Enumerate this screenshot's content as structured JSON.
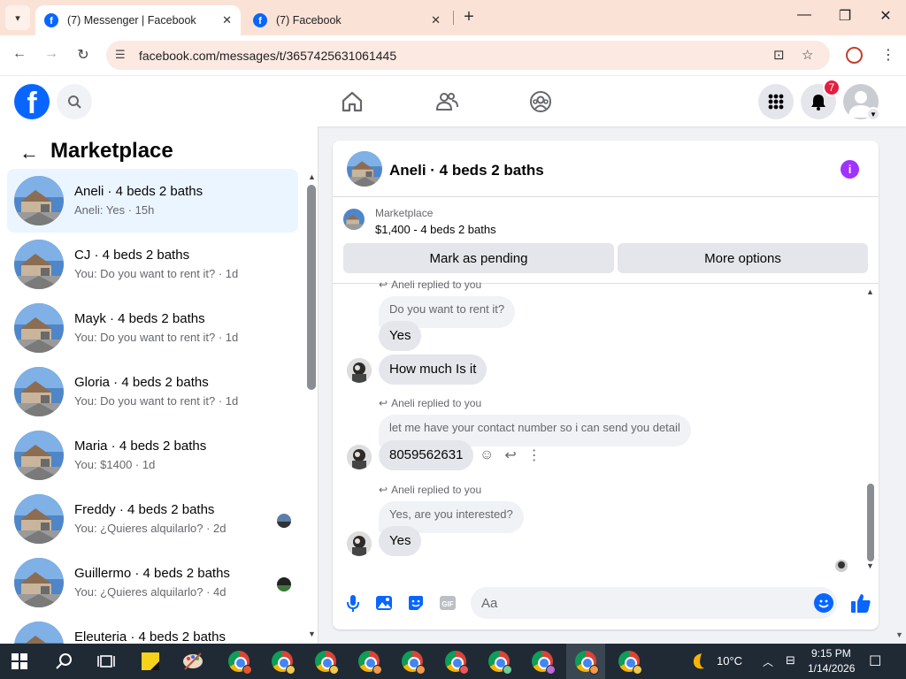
{
  "browser": {
    "tabs": [
      {
        "title": "(7) Messenger | Facebook",
        "active": true
      },
      {
        "title": "(7) Facebook",
        "active": false
      }
    ],
    "url": "facebook.com/messages/t/3657425631061445"
  },
  "header": {
    "notification_count": "7"
  },
  "sidebar": {
    "title": "Marketplace",
    "conversations": [
      {
        "name": "Aneli · 4 beds 2 baths",
        "snippet": "Aneli: Yes · 15h",
        "selected": true
      },
      {
        "name": "CJ · 4 beds 2 baths",
        "snippet": "You: Do you want to rent it? · 1d"
      },
      {
        "name": "Mayk · 4 beds 2 baths",
        "snippet": "You: Do you want to rent it? · 1d"
      },
      {
        "name": "Gloria · 4 beds 2 baths",
        "snippet": "You: Do you want to rent it? · 1d"
      },
      {
        "name": "Maria · 4 beds 2 baths",
        "snippet": "You: $1400 · 1d"
      },
      {
        "name": "Freddy · 4 beds 2 baths",
        "snippet": "You: ¿Quieres alquilarlo? · 2d"
      },
      {
        "name": "Guillermo · 4 beds 2 baths",
        "snippet": "You: ¿Quieres alquilarlo? · 4d"
      },
      {
        "name": "Eleuteria · 4 beds 2 baths",
        "snippet": ""
      }
    ]
  },
  "chat": {
    "title": "Aneli · 4 beds 2 baths",
    "listing_label": "Marketplace",
    "listing_price": "$1,400 - 4 beds 2 baths",
    "mark_pending_label": "Mark as pending",
    "more_options_label": "More options",
    "messages": [
      {
        "reply_note": "Aneli replied to you",
        "quoted": "Do you want to rent it?",
        "text": "Yes"
      },
      {
        "text": "How much Is it"
      },
      {
        "reply_note": "Aneli replied to you",
        "quoted": "let me have your contact number so i can send you detail",
        "text": "8059562631"
      },
      {
        "reply_note": "Aneli replied to you",
        "quoted": "Yes, are you interested?",
        "text": "Yes"
      }
    ],
    "composer_placeholder": "Aa"
  },
  "taskbar": {
    "temperature": "10°C",
    "time": "9:15 PM",
    "date": "1/14/2026"
  },
  "colors": {
    "fb_blue": "#0866ff",
    "selected_bg": "#ebf5ff",
    "bubble_gray": "#e4e6eb",
    "badge_red": "#e41e3f",
    "info_purple": "#a033ff"
  }
}
